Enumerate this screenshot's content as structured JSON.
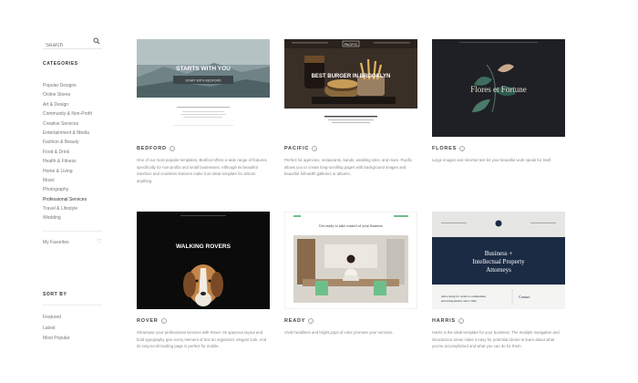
{
  "search": {
    "placeholder": "Search"
  },
  "categories": {
    "heading": "CATEGORIES",
    "items": [
      "Popular Designs",
      "Online Stores",
      "Art & Design",
      "Community & Non-Profit",
      "Creative Services",
      "Entertainment & Media",
      "Fashion & Beauty",
      "Food & Drink",
      "Health & Fitness",
      "Home & Living",
      "Music",
      "Photography",
      "Professional Services",
      "Travel & Lifestyle",
      "Wedding"
    ],
    "active_index": 12
  },
  "favorites": {
    "label": "My Favorites"
  },
  "sort": {
    "heading": "SORT BY",
    "items": [
      "Featured",
      "Latest",
      "Most Popular"
    ]
  },
  "templates": [
    {
      "name": "BEDFORD",
      "overlay_title": "STARTS WITH YOU",
      "overlay_button": "START WITH BEDFORD",
      "desc_lines": [
        "One of our most popular templates, Bedford offers a wide range of features",
        "specifically for non-profits and small businesses. Although its beautiful",
        "interface and countless features make it an ideal template for almost",
        "anything."
      ]
    },
    {
      "name": "PACIFIC",
      "overlay_title": "BEST BURGER IN BROOKLYN",
      "logo": "PACIFIC",
      "desc_lines": [
        "Perfect for agencies, restaurants, bands, wedding sites, and more. Pacific",
        "allows you to create long-scrolling pages with background images and",
        "beautiful full-width galleries or albums."
      ]
    },
    {
      "name": "FLORES",
      "overlay_title": "Flores et Fortune",
      "desc_lines": [
        "Large images and minimal text let your beautiful work speak for itself."
      ]
    },
    {
      "name": "ROVER",
      "overlay_title": "WALKING ROVERS",
      "desc_lines": [
        "Showcase your professional services with Rover. Its spacious layout and",
        "bold typography give every element of text an organized, elegant look. And",
        "its long-scroll landing page is perfect for mobile."
      ]
    },
    {
      "name": "READY",
      "overlay_title": "Get ready to take control of your finances",
      "desc_lines": [
        "Vivid headlines and bright pops of color promote your services."
      ]
    },
    {
      "name": "HARRIS",
      "overlay_title": "Business + Intellectual Property Attorneys",
      "overlay_sub": "Advocating for creative communities and entrepreneurs since 1992.",
      "overlay_contact": "Contact",
      "desc_lines": [
        "Harris is the ideal template for your business. The multiple navigation and",
        "introduction areas make it easy for potential clients to learn about what",
        "you've accomplished and what you can do for them."
      ]
    }
  ],
  "colors": {
    "accent": "#333333",
    "muted_text": "#888888",
    "harris_navy": "#1c2b44",
    "flores_bg": "#1e2025",
    "ready_green": "#6dbf8a"
  }
}
